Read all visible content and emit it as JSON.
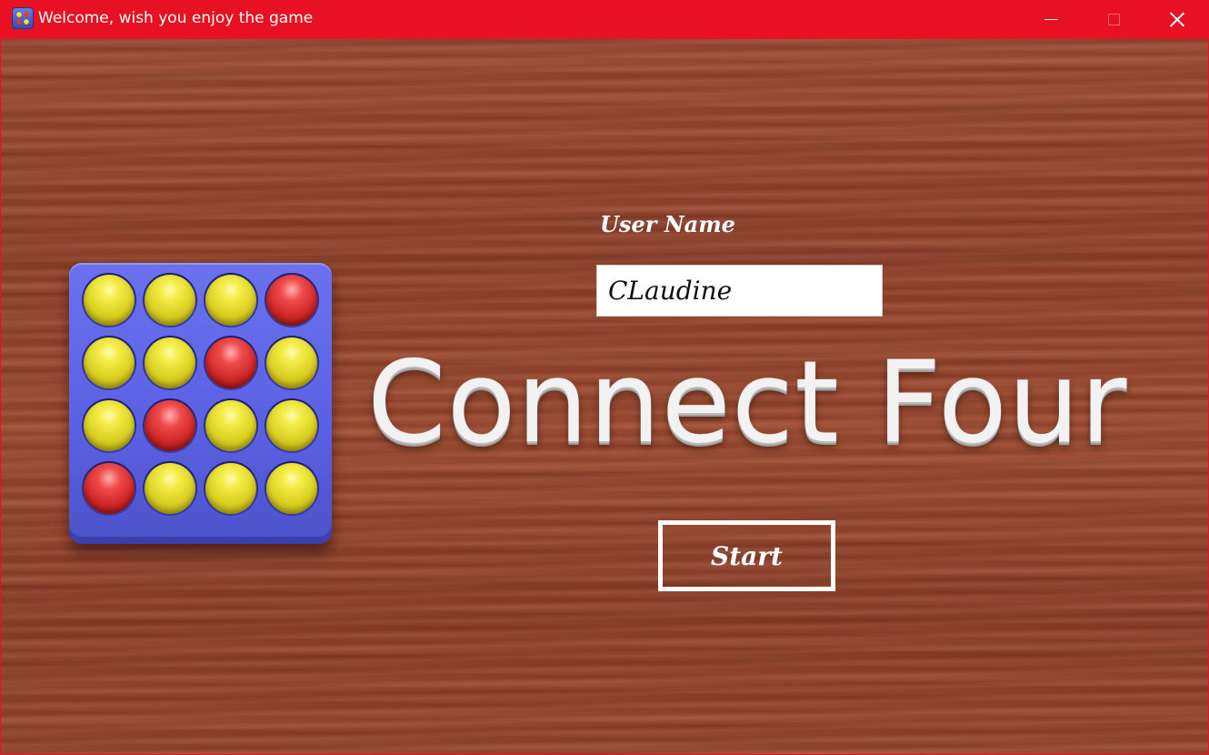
{
  "window": {
    "title": "Welcome, wish you enjoy the game",
    "title_bar_color": "#e81123",
    "controls": [
      "minimize-icon",
      "maximize-icon",
      "close-icon"
    ]
  },
  "login": {
    "username_label": "User Name",
    "username_value": "CLaudine",
    "start_label": "Start"
  },
  "logo": {
    "board_color": "#5f66e6",
    "grid": [
      [
        "yellow",
        "yellow",
        "yellow",
        "red"
      ],
      [
        "yellow",
        "yellow",
        "red",
        "yellow"
      ],
      [
        "yellow",
        "red",
        "yellow",
        "yellow"
      ],
      [
        "red",
        "yellow",
        "yellow",
        "yellow"
      ]
    ]
  },
  "game_title": "Connect Four"
}
